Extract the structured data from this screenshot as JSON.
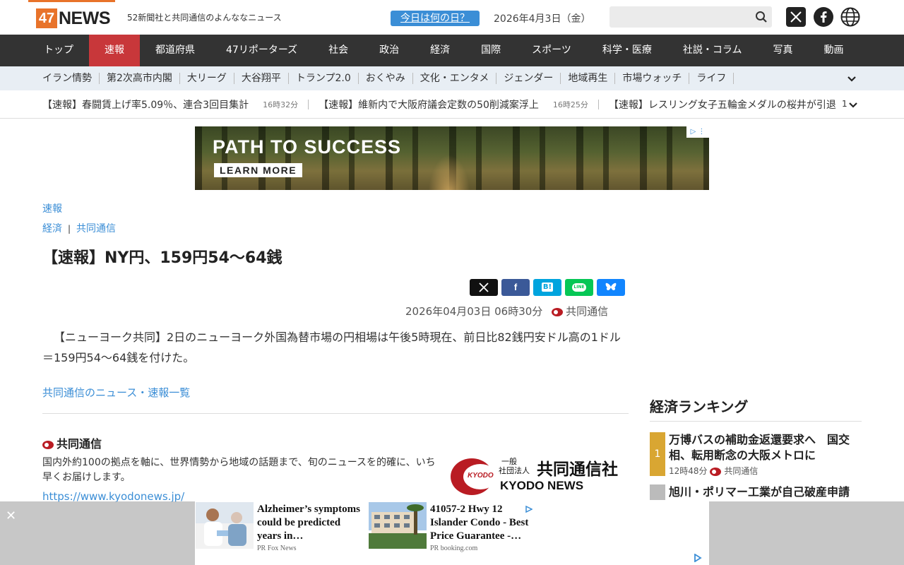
{
  "header": {
    "logo_box": "47",
    "logo_news": "NEWS",
    "tagline": "52新聞社と共同通信のよんななニュース",
    "today_button": "今日は何の日？",
    "date": "2026年4月3日（金）",
    "search_placeholder": "",
    "accent_color": "#e8732a"
  },
  "nav": {
    "items": [
      "トップ",
      "速報",
      "都道府県",
      "47リポーターズ",
      "社会",
      "政治",
      "経済",
      "国際",
      "スポーツ",
      "科学・医療",
      "社説・コラム",
      "写真",
      "動画"
    ],
    "active": "速報"
  },
  "subnav": {
    "items": [
      "イラン情勢",
      "第2次高市内閣",
      "大リーグ",
      "大谷翔平",
      "トランプ2.0",
      "おくやみ",
      "文化・エンタメ",
      "ジェンダー",
      "地域再生",
      "市場ウォッチ",
      "ライフ"
    ]
  },
  "ticker": {
    "items": [
      {
        "text": "【速報】春闘賃上げ率5.09％、連合3回目集計",
        "time": "16時32分"
      },
      {
        "text": "【速報】維新内で大阪府議会定数の50削減案浮上",
        "time": "16時25分"
      },
      {
        "text": "【速報】レスリング女子五輪金メダルの桜井が引退",
        "time": ""
      }
    ],
    "page": "1"
  },
  "banner_ad": {
    "title": "PATH TO SUCCESS",
    "cta": "LEARN MORE"
  },
  "article": {
    "crumb1": "速報",
    "crumb2_a": "経済",
    "crumb2_b": "共同通信",
    "title": "【速報】NY円、159円54～64銭",
    "datetime": "2026年04月03日 06時30分",
    "source": "共同通信",
    "body": "【ニューヨーク共同】2日のニューヨーク外国為替市場の円相場は午後5時現在、前日比82銭円安ドル高の1ドル＝159円54～64銭を付けた。",
    "list_link": "共同通信のニュース・速報一覧",
    "share_buttons": [
      "X",
      "f",
      "B!",
      "LINE",
      "bluesky"
    ]
  },
  "kyodo": {
    "title": "共同通信",
    "desc": "国内外約100の拠点を軸に、世界情勢から地域の話題まで、旬のニュースを的確に、いち早くお届けします。",
    "url": "https://www.kyodonews.jp/",
    "logo_small1": "一般",
    "logo_small2": "社団法人",
    "logo_jp": "共同通信社",
    "logo_en": "KYODO NEWS",
    "logo_mark": "KYODO"
  },
  "sidebar": {
    "title": "経済ランキング",
    "rank1": {
      "num": "1",
      "title": "万博バスの補助金返還要求へ　国交相、転用断念の大阪メトロに",
      "time": "12時48分",
      "source": "共同通信"
    },
    "rank2": {
      "title": "旭川・ポリマー工業が自己破産申請"
    }
  },
  "bottom_ad": {
    "close": "✕",
    "card1": {
      "text": "Alzheimer’s symptoms could be predicted years in…",
      "src": "PR  Fox News"
    },
    "card2": {
      "text": "41057-2 Hwy 12 Islander Condo - Best Price Guarantee -…",
      "src": "PR  booking.com"
    }
  }
}
